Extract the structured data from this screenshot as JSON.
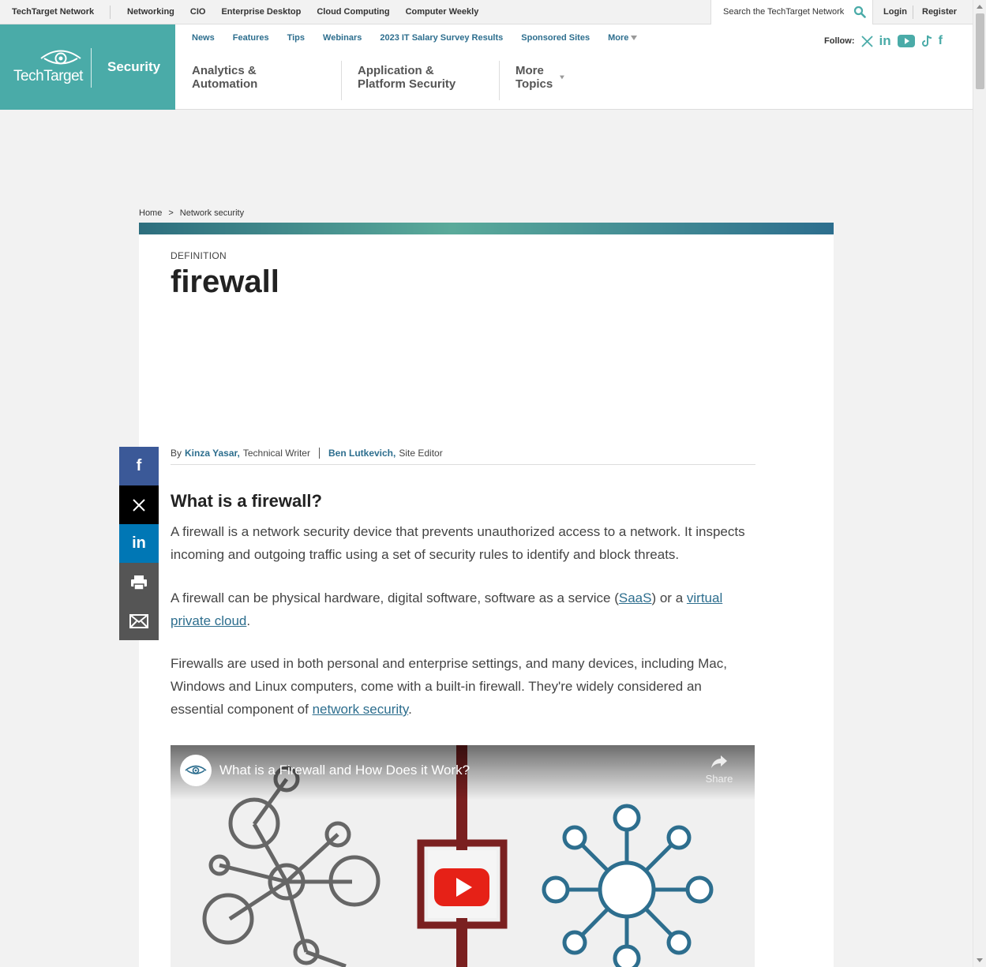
{
  "topbar": {
    "brand": "TechTarget Network",
    "sites": [
      "Networking",
      "CIO",
      "Enterprise Desktop",
      "Cloud Computing",
      "Computer Weekly"
    ],
    "search_placeholder": "Search the TechTarget Network",
    "login": "Login",
    "register": "Register"
  },
  "header": {
    "logo_text": "TechTarget",
    "section": "Security",
    "subnav": [
      "News",
      "Features",
      "Tips",
      "Webinars",
      "2023 IT Salary Survey Results",
      "Sponsored Sites",
      "More"
    ],
    "follow_label": "Follow:",
    "social_icons": [
      "x-icon",
      "linkedin-icon",
      "youtube-icon",
      "tiktok-icon",
      "facebook-icon"
    ],
    "topics": [
      "Analytics & Automation",
      "Application & Platform Security",
      "More Topics"
    ]
  },
  "breadcrumb": {
    "home": "Home",
    "sep": ">",
    "current": "Network security"
  },
  "article": {
    "kicker": "DEFINITION",
    "title": "firewall",
    "byline": {
      "by": "By",
      "author1": "Kinza Yasar,",
      "role1": "Technical Writer",
      "author2": "Ben Lutkevich,",
      "role2": "Site Editor"
    },
    "heading": "What is a firewall?",
    "p1": "A firewall is a network security device that prevents unauthorized access to a network. It inspects incoming and outgoing traffic using a set of security rules to identify and block threats.",
    "p2_before": "A firewall can be physical hardware, digital software, software as a service (",
    "p2_link1": "SaaS",
    "p2_mid": ") or a ",
    "p2_link2": "virtual private cloud",
    "p2_after": ".",
    "p3_before": "Firewalls are used in both personal and enterprise settings, and many devices, including Mac, Windows and Linux computers, come with a built-in firewall. They're widely considered an essential component of ",
    "p3_link": "network security",
    "p3_after": "."
  },
  "video": {
    "title": "What is a Firewall and How Does it Work?",
    "share": "Share"
  },
  "colors": {
    "brand_teal": "#4aaba8",
    "link_blue": "#2d6e8e",
    "youtube_red": "#e62117"
  }
}
